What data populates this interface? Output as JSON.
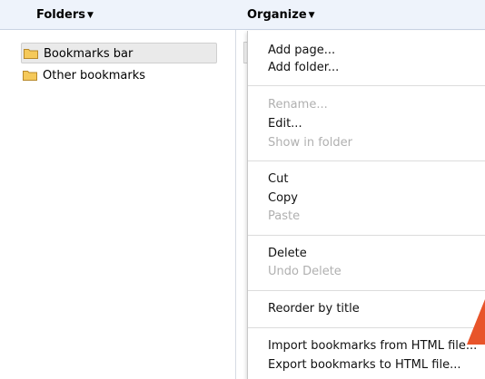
{
  "header": {
    "folders_label": "Folders",
    "organize_label": "Organize"
  },
  "tree": {
    "items": [
      {
        "label": "Bookmarks bar",
        "selected": true
      },
      {
        "label": "Other bookmarks",
        "selected": false
      }
    ]
  },
  "menu": {
    "add_page": "Add page...",
    "add_folder": "Add folder...",
    "rename": "Rename...",
    "edit": "Edit...",
    "show_in_folder": "Show in folder",
    "cut": "Cut",
    "copy": "Copy",
    "paste": "Paste",
    "delete": "Delete",
    "undo_delete": "Undo Delete",
    "reorder": "Reorder by title",
    "import": "Import bookmarks from HTML file...",
    "export": "Export bookmarks to HTML file..."
  },
  "colors": {
    "header_bg": "#eef3fb",
    "folder_fill": "#f5c95a",
    "folder_stroke": "#b8892a",
    "pointer": "#e8542a",
    "disabled_text": "#b0b0b0"
  }
}
